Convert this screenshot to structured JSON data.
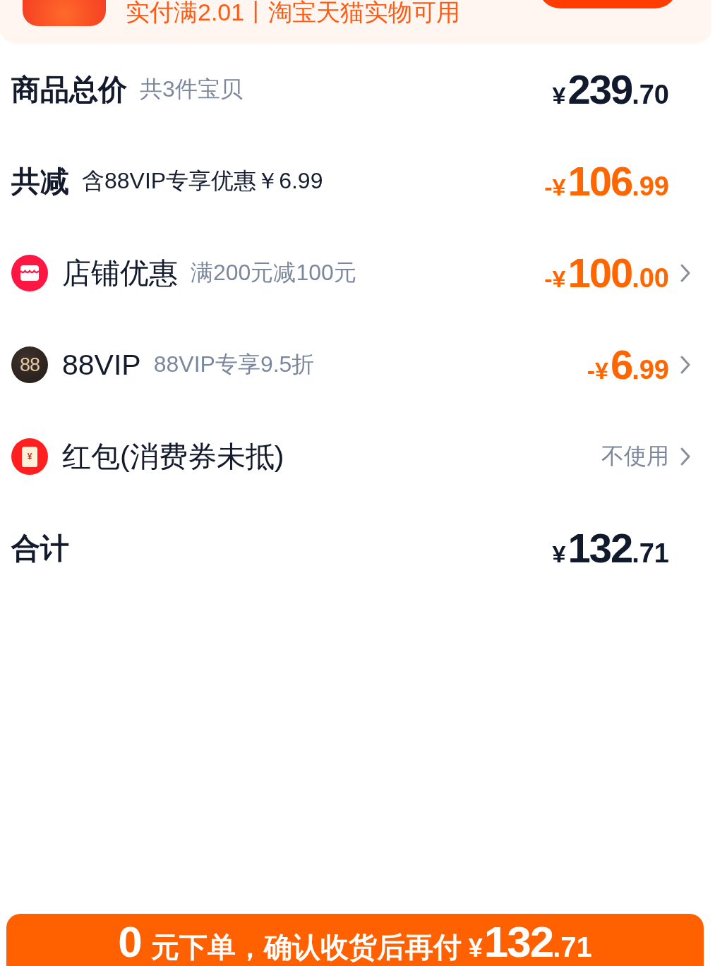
{
  "banner": {
    "text": "实付满2.01丨淘宝天猫实物可用"
  },
  "rows": [
    {
      "kind": "subtotal",
      "label": "商品总价",
      "note": "共3件宝贝",
      "amount": {
        "prefix": "¥",
        "main": "239",
        "fraction": ".70"
      },
      "chevron": false
    },
    {
      "kind": "discount_total",
      "label": "共减",
      "note": "含88VIP专享优惠￥6.99",
      "amount": {
        "prefix": "-¥",
        "main": "106",
        "fraction": ".99"
      },
      "chevron": false
    },
    {
      "kind": "shop_coupon",
      "label": "店铺优惠",
      "note": "满200元减100元",
      "amount": {
        "prefix": "-¥",
        "main": "100",
        "fraction": ".00"
      },
      "chevron": true
    },
    {
      "kind": "vip",
      "icon_text": "88",
      "label": "88VIP",
      "note": "88VIP专享9.5折",
      "amount": {
        "prefix": "-¥",
        "main": "6",
        "fraction": ".99"
      },
      "chevron": true
    },
    {
      "kind": "red_packet",
      "icon_text": "¥",
      "label": "红包(消费券未抵)",
      "value": "不使用",
      "chevron": true
    },
    {
      "kind": "total",
      "label": "合计",
      "amount": {
        "prefix": "¥",
        "main": "132",
        "fraction": ".71"
      },
      "chevron": false
    }
  ],
  "checkout_button": {
    "lead": "0",
    "text": "元下单，确认收货后再付",
    "currency": "¥",
    "main": "132",
    "fraction": ".71"
  }
}
